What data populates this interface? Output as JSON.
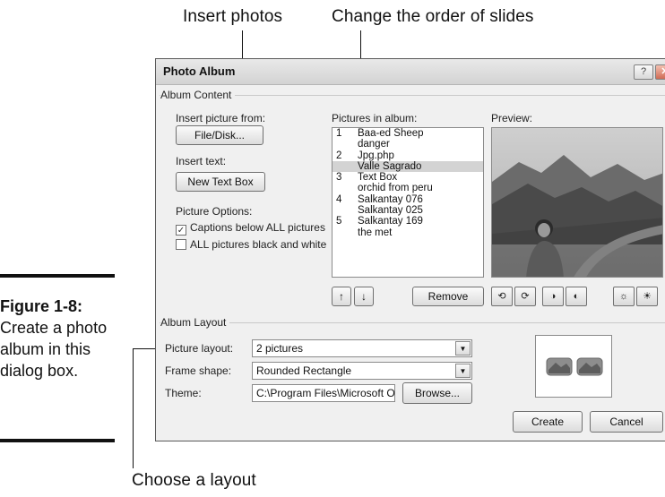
{
  "callouts": {
    "insert_photos": "Insert photos",
    "change_order": "Change the order of slides",
    "choose_layout": "Choose a layout"
  },
  "figure": {
    "number": "Figure 1-8:",
    "caption": "Create a photo album in this dialog box."
  },
  "dialog": {
    "title": "Photo Album",
    "help_label": "?",
    "close_label": "✕",
    "album_content": {
      "group_label": "Album Content",
      "insert_picture_label": "Insert picture from:",
      "file_disk_button": "File/Disk...",
      "insert_text_label": "Insert text:",
      "new_text_box_button": "New Text Box",
      "picture_options_label": "Picture Options:",
      "captions_label": "Captions below ALL pictures",
      "captions_checked": true,
      "black_white_label": "ALL pictures black and white",
      "black_white_checked": false,
      "pictures_label": "Pictures in album:",
      "pictures": [
        {
          "num": "1",
          "name": "Baa-ed Sheep",
          "selected": false
        },
        {
          "num": "",
          "name": "danger",
          "selected": false
        },
        {
          "num": "2",
          "name": "Jpg.php",
          "selected": false
        },
        {
          "num": "",
          "name": "Valle Sagrado",
          "selected": true
        },
        {
          "num": "3",
          "name": "Text Box",
          "selected": false
        },
        {
          "num": "",
          "name": "orchid from peru",
          "selected": false
        },
        {
          "num": "4",
          "name": "Salkantay 076",
          "selected": false
        },
        {
          "num": "",
          "name": "Salkantay 025",
          "selected": false
        },
        {
          "num": "5",
          "name": "Salkantay 169",
          "selected": false
        },
        {
          "num": "",
          "name": "the met",
          "selected": false
        }
      ],
      "move_up_icon": "↑",
      "move_down_icon": "↓",
      "remove_button": "Remove",
      "preview_label": "Preview:"
    },
    "album_layout": {
      "group_label": "Album Layout",
      "picture_layout_label": "Picture layout:",
      "picture_layout_value": "2 pictures",
      "frame_shape_label": "Frame shape:",
      "frame_shape_value": "Rounded Rectangle",
      "theme_label": "Theme:",
      "theme_value": "C:\\Program Files\\Microsoft Of",
      "browse_button": "Browse...",
      "dropdown_icon": "▼"
    },
    "create_button": "Create",
    "cancel_button": "Cancel"
  },
  "colors": {
    "dialog_bg": "#f0f0f0",
    "selected_row": "#d3d3d3"
  }
}
